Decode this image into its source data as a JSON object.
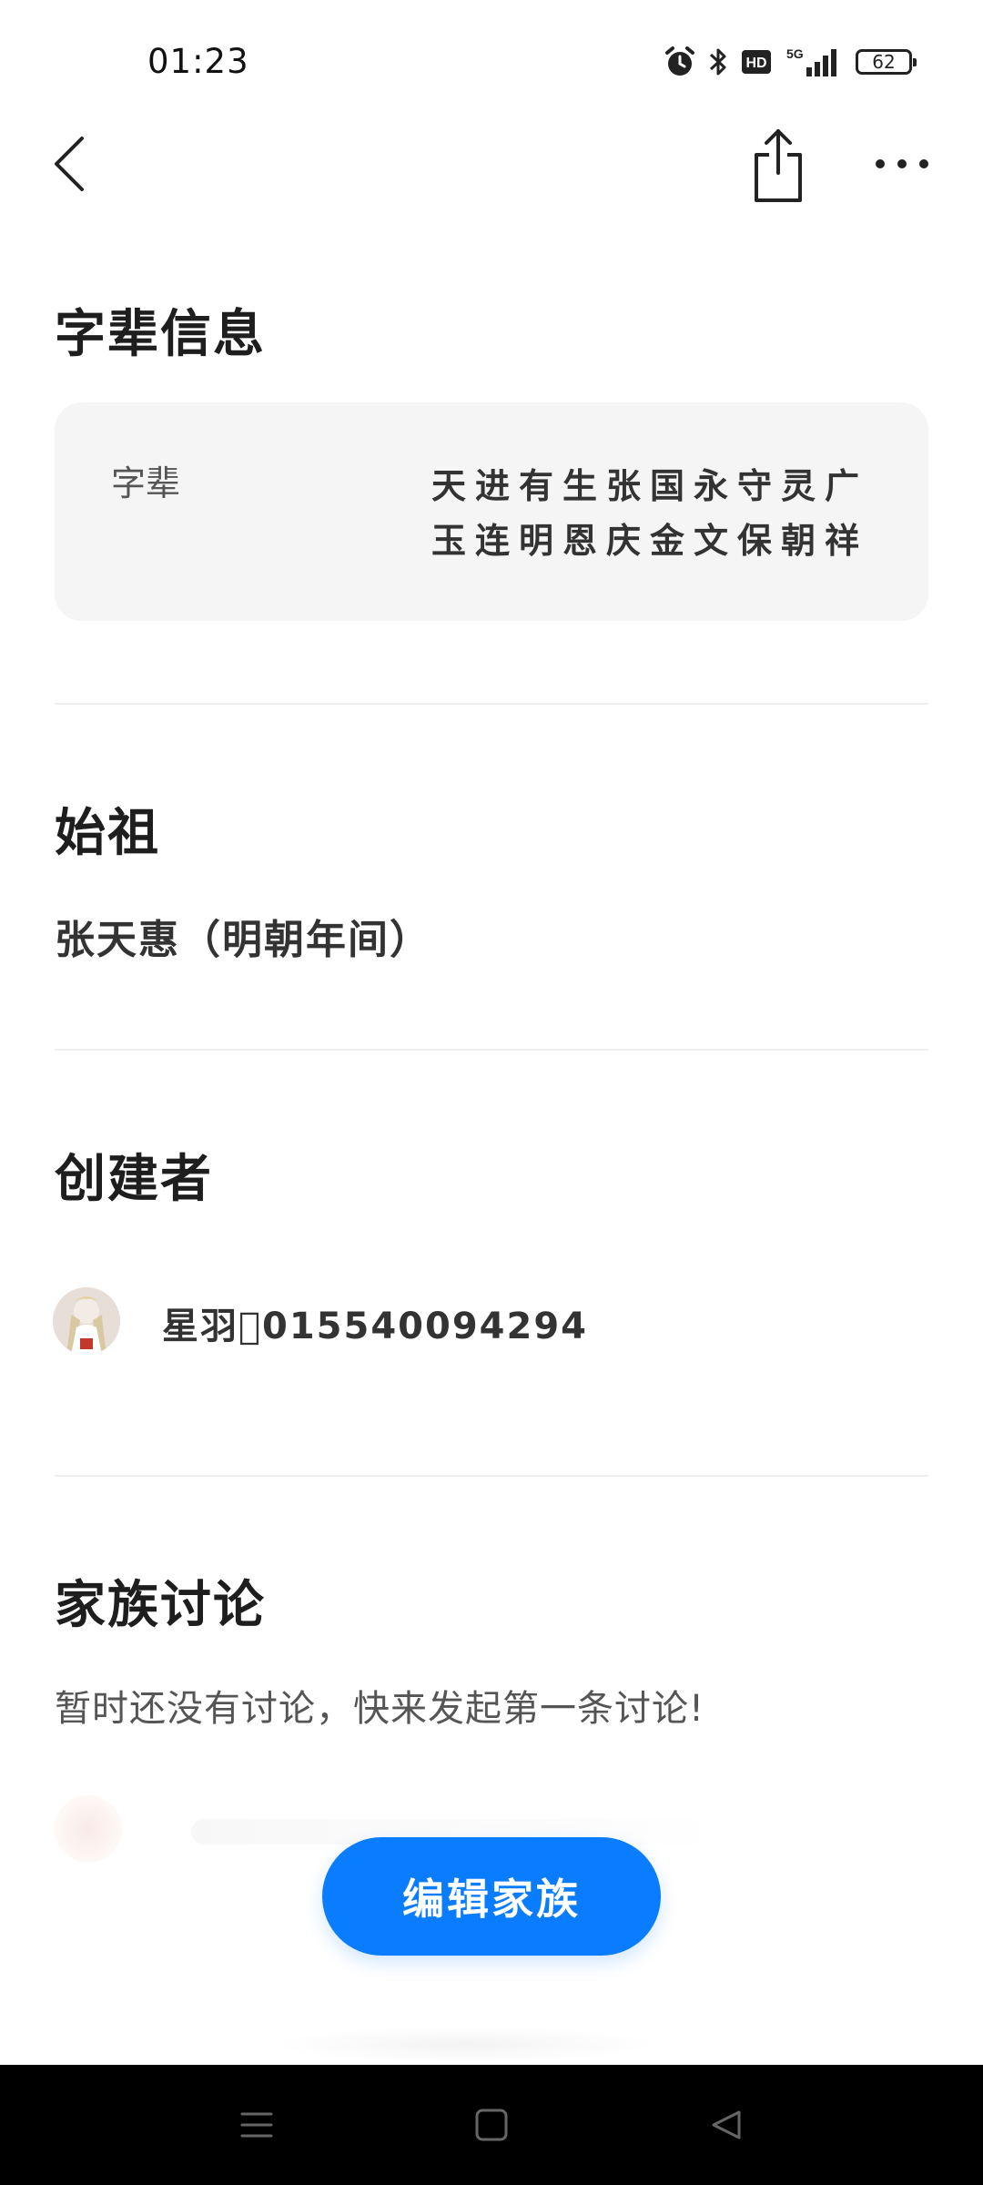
{
  "status_bar": {
    "time": "01:23",
    "icons": [
      "alarm-icon",
      "bluetooth-icon",
      "hd-icon",
      "5g-signal-icon",
      "battery-icon"
    ],
    "network": "5G",
    "hd_label": "HD",
    "battery": "62"
  },
  "nav": {
    "back_icon": "chevron-left-icon",
    "share_icon": "share-icon",
    "more_icon": "more-horizontal-icon"
  },
  "generation": {
    "title": "字辈信息",
    "label": "字辈",
    "lines": [
      "天进有生张国永守灵广",
      "玉连明恩庆金文保朝祥"
    ]
  },
  "ancestor": {
    "title": "始祖",
    "value": "张天惠（明朝年间）"
  },
  "creator": {
    "title": "创建者",
    "name": "星羽\u0000015540094294"
  },
  "discussion": {
    "title": "家族讨论",
    "empty_text": "暂时还没有讨论，快来发起第一条讨论!"
  },
  "actions": {
    "edit_label": "编辑家族"
  },
  "system_nav": {
    "icons": [
      "menu-icon",
      "home-icon",
      "back-triangle-icon"
    ]
  },
  "colors": {
    "accent": "#0a7cff",
    "card_bg": "#f5f5f5",
    "system_nav_bg": "#000000"
  }
}
